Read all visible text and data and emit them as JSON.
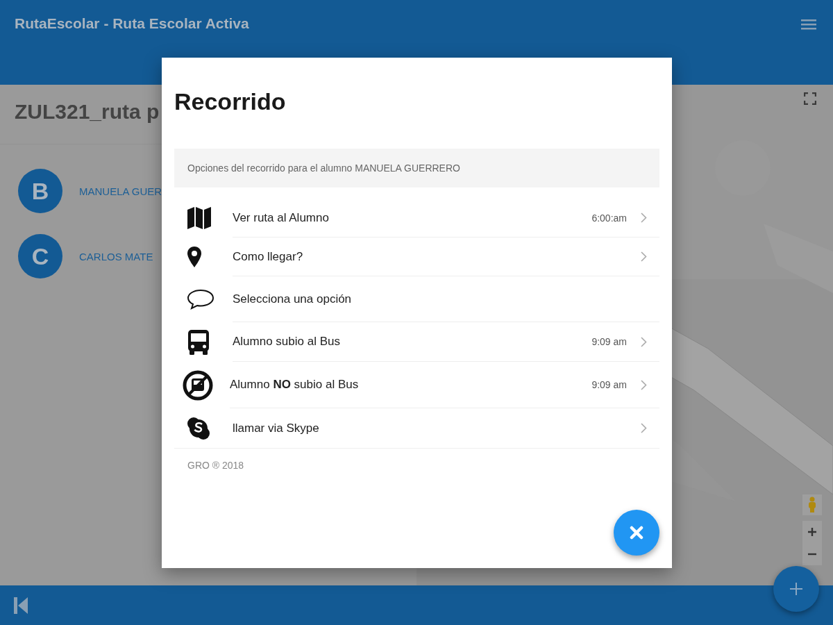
{
  "header": {
    "title": "RutaEscolar - Ruta Escolar Activa"
  },
  "route": {
    "title": "ZUL321_ruta p"
  },
  "students": [
    {
      "initial": "B",
      "name": "MANUELA GUER"
    },
    {
      "initial": "C",
      "name": "CARLOS MATE"
    }
  ],
  "dialog": {
    "title": "Recorrido",
    "subtitle": "Opciones del recorrido para el alumno MANUELA GUERRERO",
    "options": [
      {
        "label": "Ver ruta al Alumno",
        "time": "6:00:am",
        "chevron": true
      },
      {
        "label": "Como llegar?",
        "chevron": true
      },
      {
        "label": "Selecciona una opción",
        "chevron": false
      },
      {
        "label": "Alumno subio al Bus",
        "time": "9:09 am",
        "chevron": true
      },
      {
        "label": "Alumno **NO** subio al Bus",
        "time": "9:09 am",
        "chevron": true
      },
      {
        "label": "llamar via Skype",
        "chevron": true
      }
    ],
    "footer": "GRO ® 2018"
  }
}
